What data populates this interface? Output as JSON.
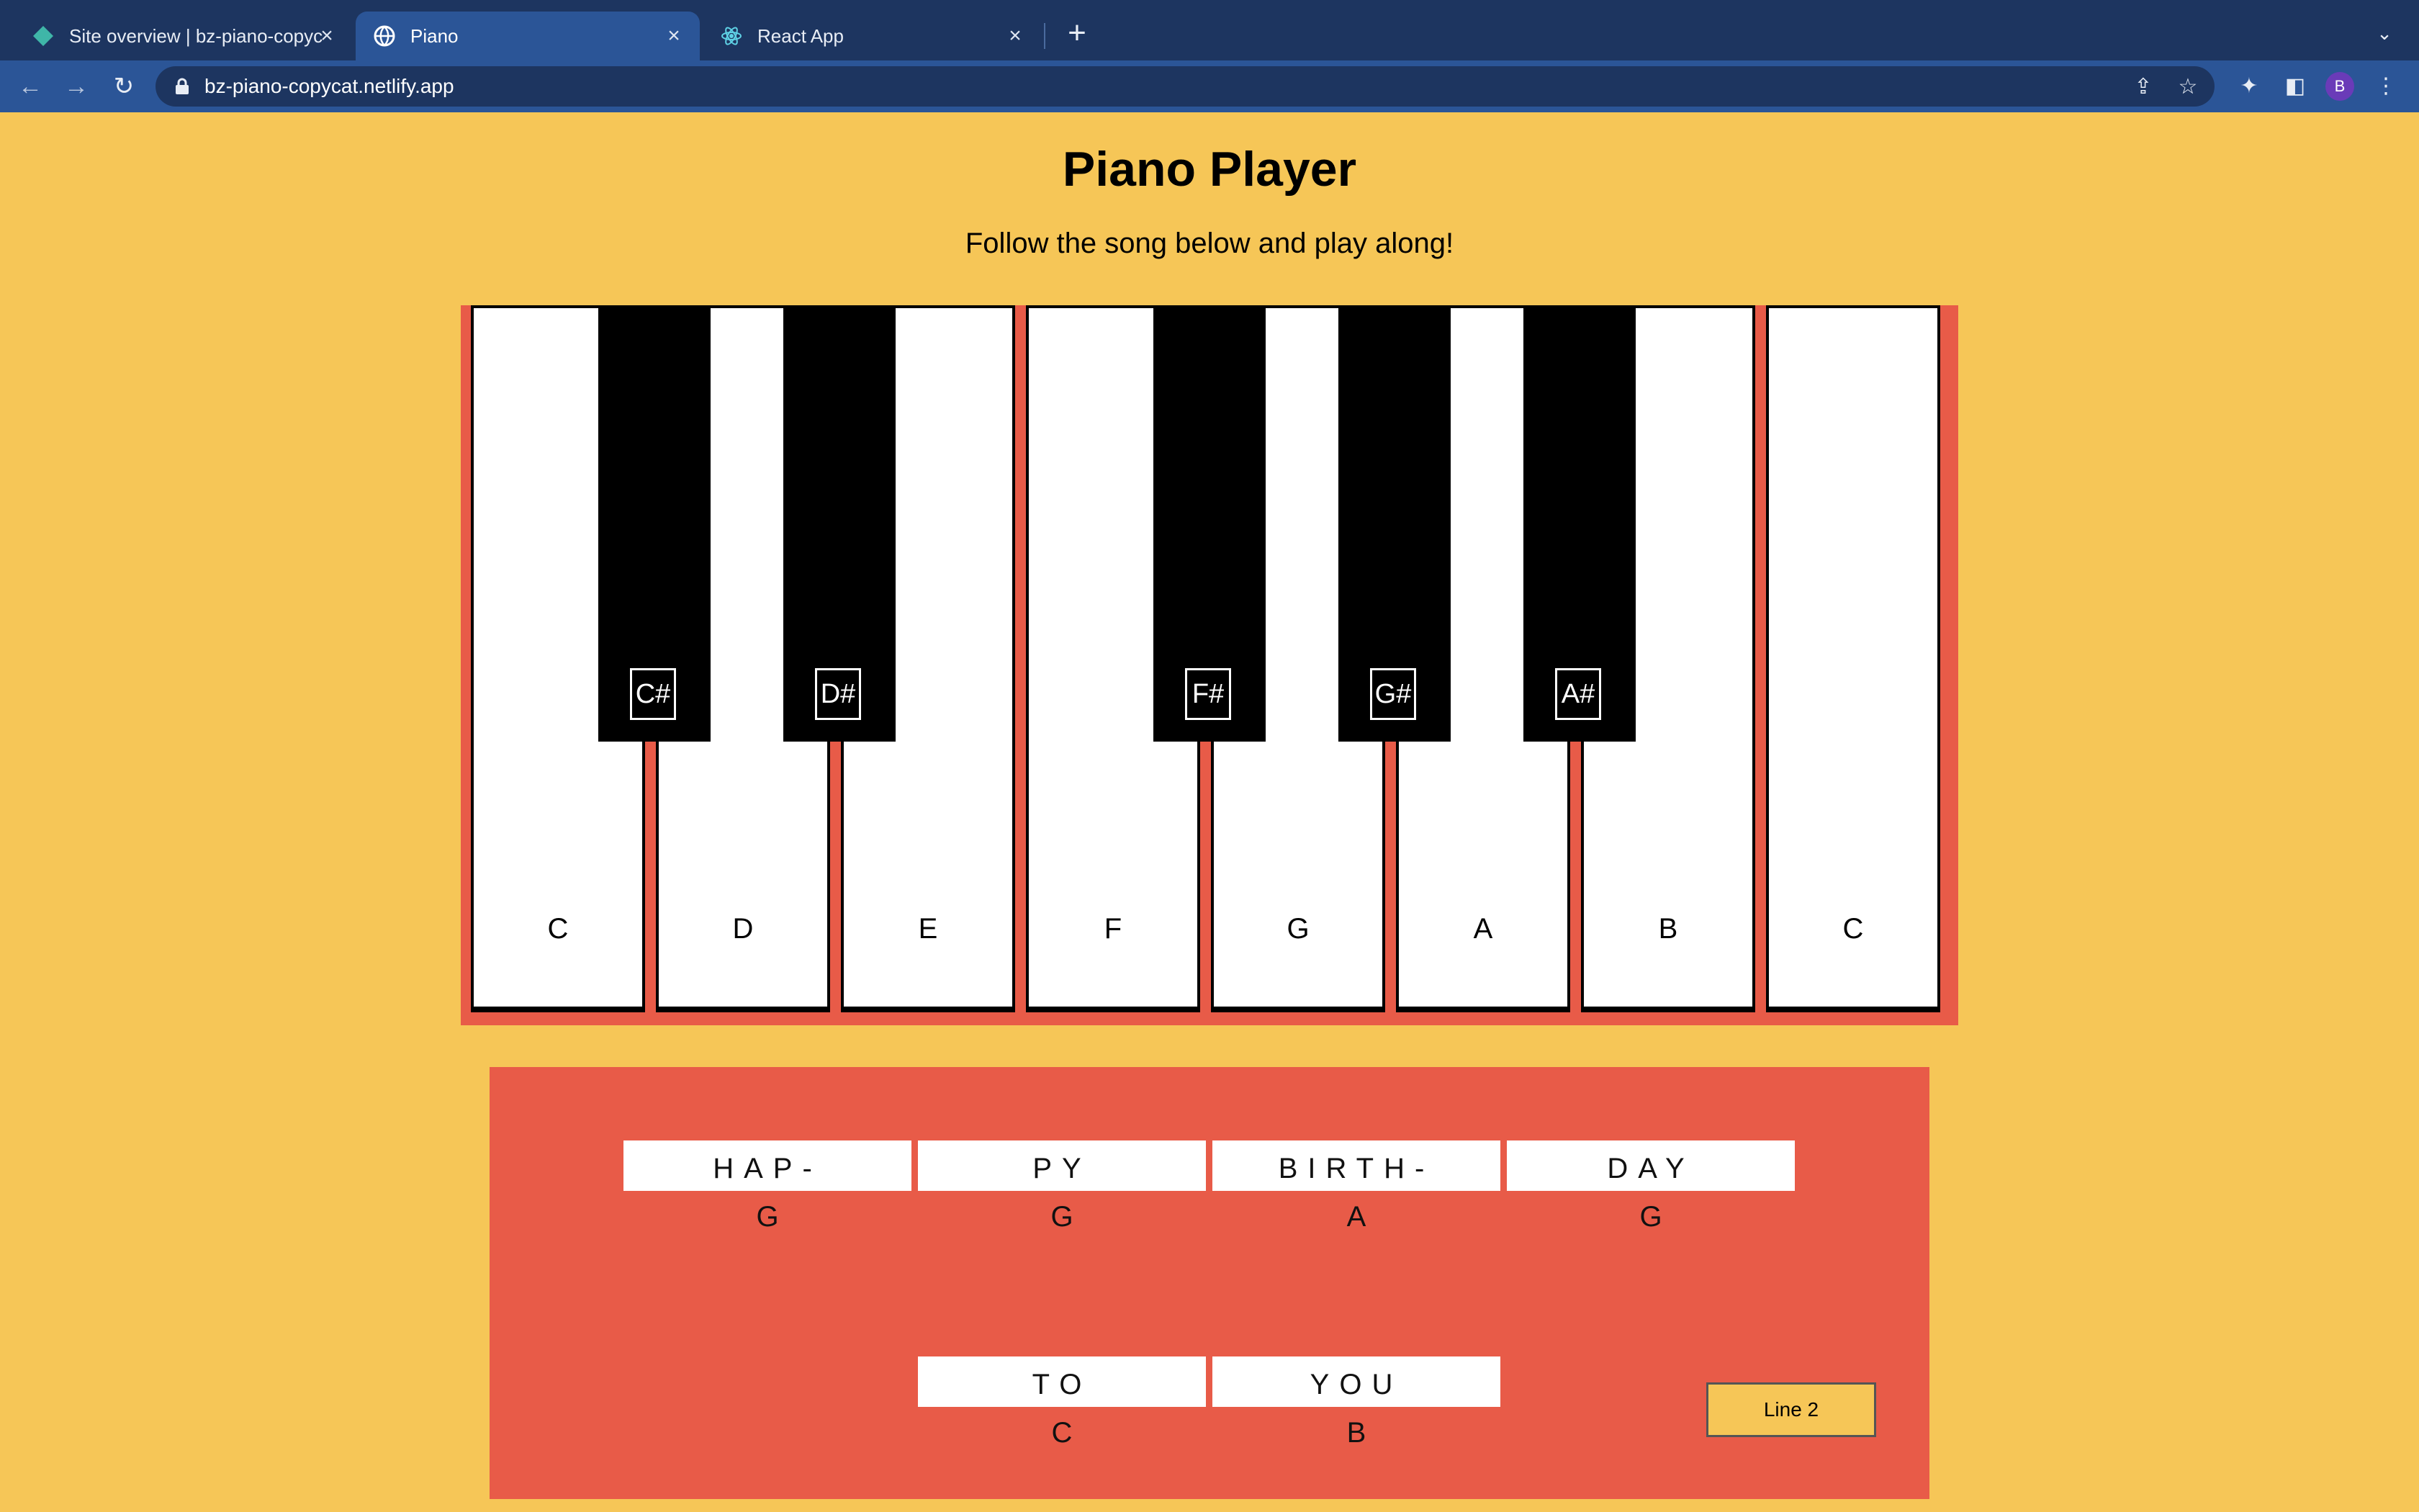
{
  "browser": {
    "tabs": [
      {
        "title": "Site overview | bz-piano-copyc",
        "icon": "netlify-diamond-icon",
        "active": false
      },
      {
        "title": "Piano",
        "icon": "globe-icon",
        "active": true
      },
      {
        "title": "React App",
        "icon": "react-atom-icon",
        "active": false
      }
    ],
    "new_tab_label": "+",
    "url": "bz-piano-copycat.netlify.app",
    "profile_initial": "B",
    "colors": {
      "tabbar": "#1d3560",
      "toolbar": "#2b5597",
      "profile": "#6a3bb8"
    }
  },
  "page": {
    "title": "Piano Player",
    "subtitle": "Follow the song below and play along!",
    "background": "#f6c657",
    "accent": "#e85b48"
  },
  "piano": {
    "white_keys": [
      "C",
      "D",
      "E",
      "F",
      "G",
      "A",
      "B",
      "C"
    ],
    "black_keys": [
      "C#",
      "D#",
      "F#",
      "G#",
      "A#"
    ]
  },
  "song": {
    "line1": [
      {
        "lyric": "HAP-",
        "note": "G"
      },
      {
        "lyric": "PY",
        "note": "G"
      },
      {
        "lyric": "BIRTH-",
        "note": "A"
      },
      {
        "lyric": "DAY",
        "note": "G"
      }
    ],
    "line2": [
      {
        "lyric": "TO",
        "note": "C"
      },
      {
        "lyric": "YOU",
        "note": "B"
      }
    ],
    "next_button_label": "Line 2"
  }
}
